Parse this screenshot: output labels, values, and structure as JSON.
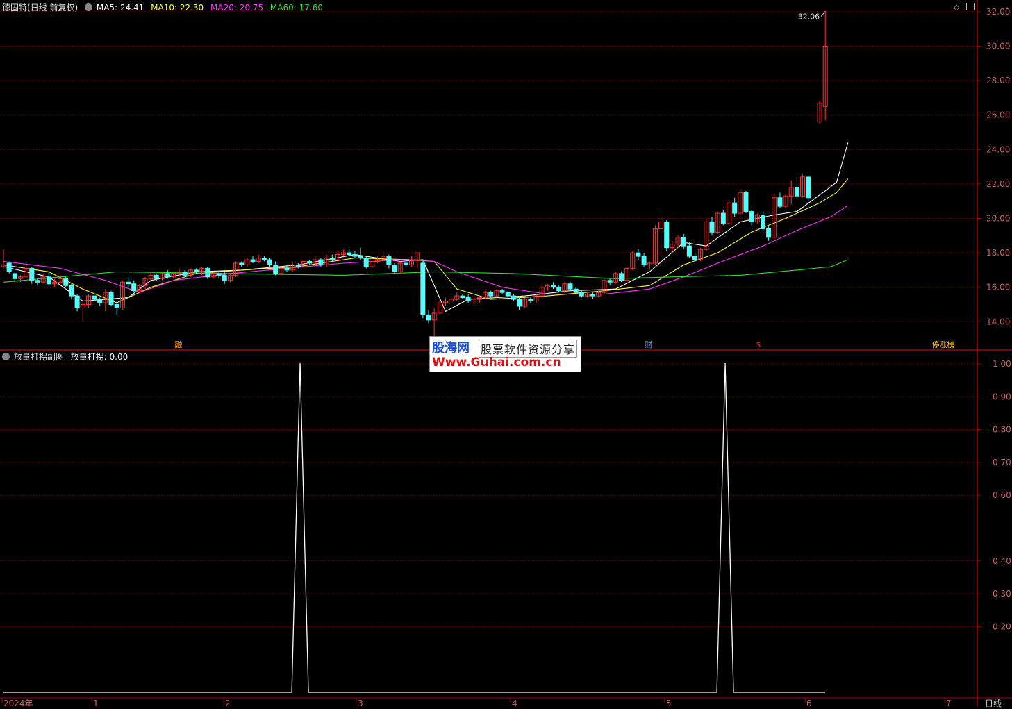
{
  "header": {
    "stock_name": "德固特",
    "stock_mode": "(日线 前复权)",
    "ma5": {
      "label": "MA5:",
      "value": "24.41",
      "color": "#ffffff"
    },
    "ma10": {
      "label": "MA10:",
      "value": "22.30",
      "color": "#ffff33"
    },
    "ma20": {
      "label": "MA20:",
      "value": "20.75",
      "color": "#ff33ff"
    },
    "ma60": {
      "label": "MA60:",
      "value": "17.60",
      "color": "#33dd33"
    }
  },
  "sub_header": {
    "name": "放量打拐副图",
    "series_label": "放量打拐:",
    "series_value": "0.00"
  },
  "watermark": {
    "line1_brand": "股海网",
    "line1_text": "股票软件资源分享",
    "line2": "Www.Guhai.com.cn"
  },
  "period_label": "日线",
  "colors": {
    "up": "#ff3232",
    "down": "#54fcfc",
    "grid": "#8b0000",
    "axis_text": "#c86464"
  },
  "chart_data": {
    "type": "candlestick",
    "price_axis": {
      "ticks": [
        "14.00",
        "16.00",
        "18.00",
        "20.00",
        "22.00",
        "24.00",
        "26.00",
        "28.00",
        "30.00",
        "32.00"
      ],
      "range": [
        12.4,
        32.6
      ]
    },
    "indicator_axis": {
      "ticks": [
        "0.20",
        "0.30",
        "0.40",
        "0.60",
        "0.70",
        "0.80",
        "0.90",
        "1.00"
      ],
      "range": [
        0,
        1.04
      ]
    },
    "x_labels": [
      "2024年",
      "1",
      "2",
      "3",
      "4",
      "5",
      "6",
      "7"
    ],
    "annotations": {
      "high": "32.06",
      "low": "12.71"
    },
    "markers": [
      "融",
      "财",
      "$",
      "停涨榜"
    ],
    "candles": [
      [
        17.2,
        18.2,
        17.1,
        17.3
      ],
      [
        17.4,
        17.5,
        16.8,
        16.9
      ],
      [
        16.8,
        16.9,
        16.3,
        16.5
      ],
      [
        16.5,
        16.7,
        16.3,
        16.6
      ],
      [
        16.6,
        17.4,
        16.5,
        17.1
      ],
      [
        17.1,
        17.2,
        16.2,
        16.4
      ],
      [
        16.4,
        16.5,
        16.1,
        16.3
      ],
      [
        16.3,
        16.8,
        16.2,
        16.6
      ],
      [
        16.6,
        16.9,
        16.1,
        16.2
      ],
      [
        16.2,
        16.5,
        16.0,
        16.3
      ],
      [
        16.3,
        16.7,
        16.2,
        16.5
      ],
      [
        16.5,
        16.6,
        16.0,
        16.1
      ],
      [
        16.1,
        16.2,
        15.3,
        15.5
      ],
      [
        15.5,
        15.6,
        14.6,
        14.8
      ],
      [
        14.8,
        15.3,
        14.0,
        15.0
      ],
      [
        15.0,
        15.6,
        14.8,
        15.5
      ],
      [
        15.5,
        15.6,
        15.1,
        15.3
      ],
      [
        15.3,
        15.4,
        14.9,
        15.1
      ],
      [
        15.1,
        15.9,
        14.6,
        15.7
      ],
      [
        15.7,
        15.8,
        14.9,
        15.0
      ],
      [
        15.0,
        15.2,
        14.4,
        14.8
      ],
      [
        14.8,
        16.4,
        14.7,
        16.3
      ],
      [
        16.3,
        16.6,
        15.9,
        16.2
      ],
      [
        16.2,
        16.4,
        15.7,
        15.8
      ],
      [
        15.8,
        16.2,
        15.6,
        16.1
      ],
      [
        16.1,
        16.6,
        15.9,
        16.5
      ],
      [
        16.5,
        16.9,
        16.3,
        16.7
      ],
      [
        16.7,
        16.8,
        16.4,
        16.5
      ],
      [
        16.5,
        16.9,
        16.4,
        16.8
      ],
      [
        16.8,
        17.0,
        16.5,
        16.6
      ],
      [
        16.6,
        16.9,
        16.5,
        16.8
      ],
      [
        16.8,
        17.1,
        16.6,
        16.9
      ],
      [
        16.9,
        17.0,
        16.6,
        16.7
      ],
      [
        16.7,
        17.1,
        16.6,
        17.0
      ],
      [
        17.0,
        17.1,
        16.8,
        16.9
      ],
      [
        16.9,
        17.2,
        16.7,
        17.1
      ],
      [
        17.1,
        17.2,
        16.5,
        16.6
      ],
      [
        16.6,
        16.9,
        16.5,
        16.8
      ],
      [
        16.8,
        16.9,
        16.5,
        16.7
      ],
      [
        16.7,
        17.0,
        16.2,
        16.4
      ],
      [
        16.4,
        16.8,
        16.3,
        16.7
      ],
      [
        16.7,
        17.5,
        16.6,
        17.4
      ],
      [
        17.4,
        17.5,
        17.2,
        17.3
      ],
      [
        17.3,
        17.7,
        17.2,
        17.6
      ],
      [
        17.6,
        17.8,
        17.4,
        17.5
      ],
      [
        17.5,
        17.9,
        17.4,
        17.7
      ],
      [
        17.7,
        17.8,
        17.5,
        17.6
      ],
      [
        17.6,
        17.7,
        17.2,
        17.3
      ],
      [
        17.3,
        17.5,
        16.7,
        16.8
      ],
      [
        16.8,
        17.2,
        16.7,
        17.1
      ],
      [
        17.1,
        17.3,
        16.9,
        17.0
      ],
      [
        17.0,
        17.5,
        16.9,
        17.3
      ],
      [
        17.3,
        17.4,
        17.1,
        17.2
      ],
      [
        17.2,
        17.6,
        17.1,
        17.5
      ],
      [
        17.5,
        17.6,
        17.3,
        17.4
      ],
      [
        17.4,
        17.8,
        17.3,
        17.6
      ],
      [
        17.6,
        17.7,
        17.2,
        17.3
      ],
      [
        17.3,
        17.9,
        17.2,
        17.7
      ],
      [
        17.7,
        17.9,
        17.5,
        17.6
      ],
      [
        17.6,
        18.1,
        17.5,
        17.9
      ],
      [
        17.9,
        18.2,
        17.8,
        18.0
      ],
      [
        18.0,
        18.2,
        17.8,
        17.9
      ],
      [
        17.9,
        18.1,
        17.7,
        17.8
      ],
      [
        17.8,
        18.3,
        17.6,
        17.7
      ],
      [
        17.7,
        17.8,
        17.1,
        17.2
      ],
      [
        17.2,
        17.6,
        16.8,
        17.5
      ],
      [
        17.5,
        17.8,
        17.4,
        17.6
      ],
      [
        17.6,
        18.0,
        17.5,
        17.8
      ],
      [
        17.8,
        17.9,
        17.1,
        17.3
      ],
      [
        17.3,
        17.4,
        16.8,
        16.9
      ],
      [
        16.9,
        17.5,
        16.8,
        17.4
      ],
      [
        17.4,
        17.6,
        17.2,
        17.3
      ],
      [
        17.3,
        17.8,
        17.2,
        17.6
      ],
      [
        17.6,
        18.0,
        17.1,
        18.0
      ],
      [
        17.4,
        17.5,
        14.2,
        14.4
      ],
      [
        14.4,
        14.7,
        13.9,
        14.1
      ],
      [
        14.1,
        14.8,
        12.71,
        14.5
      ],
      [
        14.5,
        15.3,
        14.4,
        15.1
      ],
      [
        15.1,
        15.4,
        14.9,
        15.2
      ],
      [
        15.2,
        15.5,
        15.0,
        15.3
      ],
      [
        15.3,
        15.7,
        15.2,
        15.5
      ],
      [
        15.5,
        15.6,
        15.3,
        15.4
      ],
      [
        15.4,
        15.6,
        15.1,
        15.2
      ],
      [
        15.2,
        15.4,
        15.0,
        15.3
      ],
      [
        15.3,
        15.5,
        15.1,
        15.4
      ],
      [
        15.4,
        15.8,
        15.3,
        15.7
      ],
      [
        15.7,
        15.8,
        15.4,
        15.5
      ],
      [
        15.5,
        15.9,
        15.4,
        15.8
      ],
      [
        15.8,
        15.9,
        15.6,
        15.7
      ],
      [
        15.7,
        15.8,
        15.4,
        15.5
      ],
      [
        15.5,
        15.6,
        15.2,
        15.3
      ],
      [
        15.3,
        15.5,
        14.7,
        14.9
      ],
      [
        14.9,
        15.4,
        14.8,
        15.3
      ],
      [
        15.3,
        15.4,
        15.1,
        15.2
      ],
      [
        15.2,
        15.6,
        15.1,
        15.5
      ],
      [
        15.5,
        16.1,
        15.4,
        16.0
      ],
      [
        16.0,
        16.2,
        15.8,
        16.1
      ],
      [
        16.1,
        16.3,
        15.9,
        16.0
      ],
      [
        16.0,
        16.1,
        15.7,
        15.8
      ],
      [
        15.8,
        16.3,
        15.7,
        16.2
      ],
      [
        16.2,
        16.3,
        15.8,
        15.9
      ],
      [
        15.9,
        16.0,
        15.6,
        15.7
      ],
      [
        15.7,
        15.8,
        15.4,
        15.5
      ],
      [
        15.5,
        15.7,
        15.4,
        15.6
      ],
      [
        15.6,
        15.7,
        15.3,
        15.5
      ],
      [
        15.5,
        15.8,
        15.4,
        15.7
      ],
      [
        15.7,
        16.5,
        15.6,
        16.4
      ],
      [
        16.4,
        16.5,
        16.1,
        16.3
      ],
      [
        16.3,
        16.9,
        16.2,
        16.8
      ],
      [
        16.8,
        16.9,
        16.3,
        16.4
      ],
      [
        16.4,
        17.2,
        16.3,
        17.1
      ],
      [
        17.1,
        18.1,
        17.0,
        18.0
      ],
      [
        18.0,
        18.2,
        17.6,
        17.8
      ],
      [
        17.8,
        18.0,
        17.2,
        17.3
      ],
      [
        17.3,
        17.5,
        17.0,
        17.4
      ],
      [
        17.4,
        19.6,
        17.3,
        19.4
      ],
      [
        19.4,
        20.5,
        18.0,
        19.8
      ],
      [
        19.8,
        19.9,
        18.1,
        18.3
      ],
      [
        18.3,
        18.7,
        18.0,
        18.5
      ],
      [
        18.5,
        19.0,
        18.3,
        18.9
      ],
      [
        18.9,
        19.1,
        18.2,
        18.4
      ],
      [
        18.4,
        18.6,
        17.7,
        17.8
      ],
      [
        17.8,
        18.0,
        17.5,
        17.6
      ],
      [
        17.6,
        18.3,
        17.5,
        18.2
      ],
      [
        18.2,
        20.0,
        18.1,
        19.8
      ],
      [
        19.8,
        20.1,
        19.0,
        19.2
      ],
      [
        19.2,
        20.4,
        19.1,
        20.3
      ],
      [
        20.3,
        20.5,
        19.6,
        19.7
      ],
      [
        19.7,
        21.1,
        19.5,
        20.9
      ],
      [
        20.9,
        21.2,
        20.1,
        20.3
      ],
      [
        20.3,
        21.7,
        20.2,
        21.5
      ],
      [
        21.5,
        21.6,
        20.3,
        20.4
      ],
      [
        20.4,
        20.5,
        19.6,
        19.8
      ],
      [
        19.8,
        20.3,
        19.7,
        20.2
      ],
      [
        20.2,
        20.4,
        19.3,
        19.4
      ],
      [
        19.4,
        19.6,
        18.7,
        18.9
      ],
      [
        18.9,
        21.4,
        18.8,
        21.2
      ],
      [
        21.2,
        21.5,
        20.6,
        20.7
      ],
      [
        20.7,
        21.4,
        20.6,
        21.3
      ],
      [
        21.3,
        22.2,
        20.8,
        21.8
      ],
      [
        21.8,
        22.4,
        21.2,
        21.3
      ],
      [
        21.3,
        22.6,
        21.2,
        22.4
      ],
      [
        22.4,
        22.5,
        21.0,
        21.2
      ],
      [
        null,
        null,
        null,
        null
      ],
      [
        25.6,
        26.8,
        25.5,
        26.7
      ],
      [
        26.5,
        32.06,
        25.7,
        30.0
      ]
    ],
    "ma_series": [
      {
        "name": "MA5",
        "color": "#ffffff",
        "points": [
          [
            0,
            17.2
          ],
          [
            8,
            16.6
          ],
          [
            14,
            15.2
          ],
          [
            18,
            15.3
          ],
          [
            22,
            15.4
          ],
          [
            26,
            16.4
          ],
          [
            34,
            16.9
          ],
          [
            42,
            17.0
          ],
          [
            52,
            17.3
          ],
          [
            62,
            17.9
          ],
          [
            70,
            17.5
          ],
          [
            74,
            17.6
          ],
          [
            78,
            14.6
          ],
          [
            82,
            15.3
          ],
          [
            92,
            15.5
          ],
          [
            100,
            15.8
          ],
          [
            108,
            15.9
          ],
          [
            114,
            16.9
          ],
          [
            120,
            18.6
          ],
          [
            124,
            18.4
          ],
          [
            130,
            19.8
          ],
          [
            136,
            20.2
          ],
          [
            140,
            20.4
          ],
          [
            145,
            21.6
          ],
          [
            147,
            22.1
          ],
          [
            149,
            24.4
          ]
        ]
      },
      {
        "name": "MA10",
        "color": "#ffff33",
        "points": [
          [
            0,
            17.3
          ],
          [
            8,
            16.9
          ],
          [
            14,
            15.9
          ],
          [
            20,
            15.1
          ],
          [
            26,
            16.0
          ],
          [
            34,
            16.8
          ],
          [
            42,
            17.0
          ],
          [
            52,
            17.2
          ],
          [
            62,
            17.7
          ],
          [
            72,
            17.6
          ],
          [
            76,
            17.5
          ],
          [
            80,
            15.9
          ],
          [
            86,
            15.3
          ],
          [
            96,
            15.5
          ],
          [
            106,
            15.8
          ],
          [
            114,
            16.1
          ],
          [
            120,
            17.3
          ],
          [
            126,
            18.0
          ],
          [
            132,
            19.2
          ],
          [
            138,
            20.0
          ],
          [
            144,
            20.9
          ],
          [
            147,
            21.5
          ],
          [
            149,
            22.3
          ]
        ]
      },
      {
        "name": "MA20",
        "color": "#ff33ff",
        "points": [
          [
            0,
            17.5
          ],
          [
            10,
            17.1
          ],
          [
            18,
            16.4
          ],
          [
            24,
            15.7
          ],
          [
            30,
            16.4
          ],
          [
            40,
            16.8
          ],
          [
            50,
            17.1
          ],
          [
            60,
            17.4
          ],
          [
            70,
            17.6
          ],
          [
            76,
            17.5
          ],
          [
            80,
            16.9
          ],
          [
            88,
            16.0
          ],
          [
            96,
            15.6
          ],
          [
            106,
            15.6
          ],
          [
            114,
            15.9
          ],
          [
            120,
            16.6
          ],
          [
            126,
            17.4
          ],
          [
            134,
            18.4
          ],
          [
            140,
            19.3
          ],
          [
            146,
            20.1
          ],
          [
            149,
            20.75
          ]
        ]
      },
      {
        "name": "MA60",
        "color": "#33dd33",
        "points": [
          [
            0,
            16.3
          ],
          [
            20,
            16.9
          ],
          [
            40,
            16.8
          ],
          [
            60,
            16.7
          ],
          [
            76,
            16.9
          ],
          [
            90,
            16.8
          ],
          [
            108,
            16.5
          ],
          [
            118,
            16.6
          ],
          [
            130,
            16.7
          ],
          [
            140,
            17.0
          ],
          [
            146,
            17.2
          ],
          [
            149,
            17.6
          ]
        ]
      }
    ],
    "indicator_series": {
      "name": "放量打拐",
      "values": [
        0,
        0,
        0,
        0,
        0,
        0,
        0,
        0,
        0,
        0,
        0,
        0,
        0,
        0,
        0,
        0,
        0,
        0,
        0,
        0,
        0,
        0,
        0,
        0,
        0,
        0,
        0,
        0,
        0,
        0,
        0,
        0,
        0,
        0,
        0,
        0,
        0,
        0,
        0,
        0,
        0,
        0,
        0,
        0,
        0,
        0,
        0,
        0,
        0,
        0,
        0,
        0,
        0,
        0,
        0,
        0,
        0,
        0,
        0,
        0,
        0,
        0,
        0,
        0,
        0,
        0,
        0,
        0,
        0,
        0,
        0,
        0,
        0,
        0,
        0,
        0,
        0,
        0,
        0,
        0,
        0,
        0,
        0,
        0,
        0,
        0,
        0,
        0,
        0,
        0,
        0,
        0,
        0,
        0,
        0,
        0,
        0,
        0,
        0,
        0,
        0,
        0,
        0,
        0,
        0,
        0,
        0,
        0,
        0,
        0,
        0,
        0,
        0,
        0,
        0,
        0,
        0,
        0,
        0,
        0,
        0,
        0,
        0,
        0,
        0,
        0,
        0,
        0,
        0,
        0,
        0,
        0,
        0,
        0,
        0,
        0,
        0,
        0,
        0,
        0,
        0,
        0,
        0,
        0,
        0,
        0,
        0,
        0,
        0,
        0
      ],
      "spikes": [
        [
          41,
          1.0
        ],
        [
          116,
          1.0
        ]
      ]
    }
  }
}
